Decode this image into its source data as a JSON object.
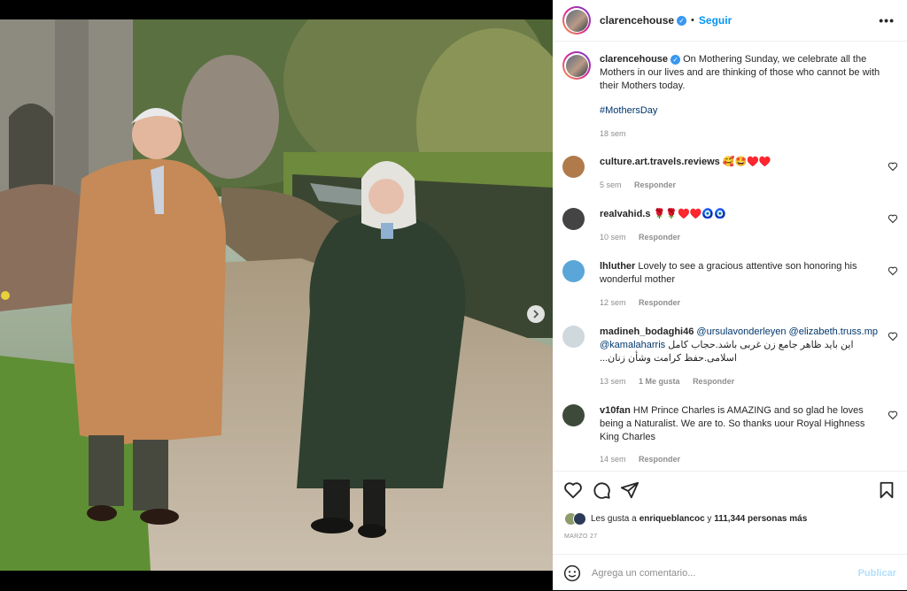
{
  "post": {
    "username": "clarencehouse",
    "follow_label": "Seguir",
    "dot": "•",
    "more_label": "•••",
    "verified_mark": "✓"
  },
  "caption": {
    "username": "clarencehouse",
    "text": "On Mothering Sunday, we celebrate all the Mothers in our lives and are thinking of those who cannot be with their Mothers today.",
    "hashtag": "#MothersDay",
    "time": "18 sem"
  },
  "comments": [
    {
      "username": "culture.art.travels.reviews",
      "text": "🥰🤩♥️♥️",
      "time": "5 sem",
      "reply": "Responder",
      "avatar_color": "#b07a4a"
    },
    {
      "username": "realvahid.s",
      "text": "🌹🌹♥️♥️🧿🧿",
      "time": "10 sem",
      "reply": "Responder",
      "avatar_color": "#444444"
    },
    {
      "username": "lhluther",
      "text": "Lovely to see a gracious attentive son honoring his wonderful mother",
      "time": "12 sem",
      "reply": "Responder",
      "avatar_color": "#5aa6d8"
    },
    {
      "username": "madineh_bodaghi46",
      "mention1": "@ursulavonderleyen",
      "mention2": "@elizabeth.truss.mp",
      "mention3": "@kamalaharris",
      "text_rtl": "این باید ظاهر جامع زن غربی باشد.حجاب کامل",
      "text_rtl2": "اسلامی.حفظ کرامت وشأن زنان...",
      "time": "13 sem",
      "likes": "1 Me gusta",
      "reply": "Responder",
      "avatar_color": "#cfd8dc"
    },
    {
      "username": "v10fan",
      "text": "HM Prince Charles is AMAZING and so glad he loves being a Naturalist. We are to. So thanks uour Royal Highness King Charles",
      "time": "14 sem",
      "reply": "Responder",
      "avatar_color": "#3d4a3a"
    }
  ],
  "likes": {
    "prefix": "Les gusta a ",
    "user": "enriqueblancoc",
    "middle": " y ",
    "count": "111,344 personas más"
  },
  "date": "MARZO 27",
  "comment_box": {
    "placeholder": "Agrega un comentario...",
    "publish_label": "Publicar"
  },
  "icons": [
    "chevron-right-icon",
    "verified-icon",
    "more-icon",
    "heart-icon",
    "comment-icon",
    "share-icon",
    "bookmark-icon",
    "emoji-icon"
  ]
}
